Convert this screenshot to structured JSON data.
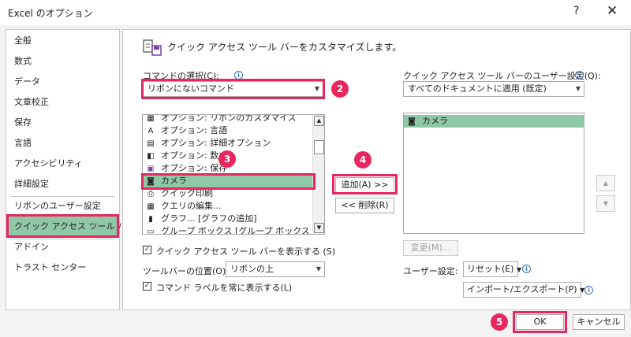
{
  "window": {
    "title": "Excel のオプション",
    "help": "?",
    "close": "✕"
  },
  "sidebar": {
    "items": [
      {
        "label": "全般"
      },
      {
        "label": "数式"
      },
      {
        "label": "データ"
      },
      {
        "label": "文章校正"
      },
      {
        "label": "保存"
      },
      {
        "label": "言語"
      },
      {
        "label": "アクセシビリティ"
      },
      {
        "label": "詳細設定"
      },
      {
        "label": "リボンのユーザー設定"
      },
      {
        "label": "クイック アクセス ツール バー"
      },
      {
        "label": "アドイン"
      },
      {
        "label": "トラスト センター"
      }
    ],
    "selected": "クイック アクセス ツール バー"
  },
  "header": {
    "title": "クイック アクセス ツール バーをカスタマイズします。"
  },
  "commands": {
    "label": "コマンドの選択(C):",
    "selected": "リボンにないコマンド",
    "list": [
      {
        "icon": "▦",
        "label": "オプション: リボンのカスタマイズ"
      },
      {
        "icon": "A",
        "label": "オプション: 言語"
      },
      {
        "icon": "▤",
        "label": "オプション: 詳細オプション"
      },
      {
        "icon": "◧",
        "label": "オプション: 数式"
      },
      {
        "icon": "▣",
        "label": "オプション: 保存"
      },
      {
        "icon": "◙",
        "label": "カメラ"
      },
      {
        "icon": "⎙",
        "label": "クイック印刷"
      },
      {
        "icon": "▦",
        "label": "クエリの編集..."
      },
      {
        "icon": "▮",
        "label": "グラフ... [グラフの追加]"
      },
      {
        "icon": "▭",
        "label": "グループ ボックス [グループ ボックス"
      }
    ],
    "selected_item": "カメラ"
  },
  "buttons": {
    "add": "追加(A) >>",
    "remove": "<< 削除(R)",
    "modify": "変更(M)...",
    "reset": "リセット(E)",
    "import_export": "インポート/エクスポート(P)",
    "ok": "OK",
    "cancel": "キャンセル"
  },
  "qat": {
    "label": "クイック アクセス ツール バーのユーザー設定(Q):",
    "selected": "すべてのドキュメントに適用 (既定)",
    "items": [
      {
        "icon": "◙",
        "label": "カメラ"
      }
    ]
  },
  "options": {
    "show_qat": "クイック アクセス ツール バーを表示する (S)",
    "position_label": "ツールバーの位置(O)",
    "position_value": "リボンの上",
    "show_labels": "コマンド ラベルを常に表示する(L)",
    "user_settings_label": "ユーザー設定:"
  },
  "badges": {
    "b1": "1",
    "b2": "2",
    "b3": "3",
    "b4": "4",
    "b5": "5"
  },
  "colors": {
    "highlight": "#8fc8a6",
    "annotation": "#e8275e"
  }
}
